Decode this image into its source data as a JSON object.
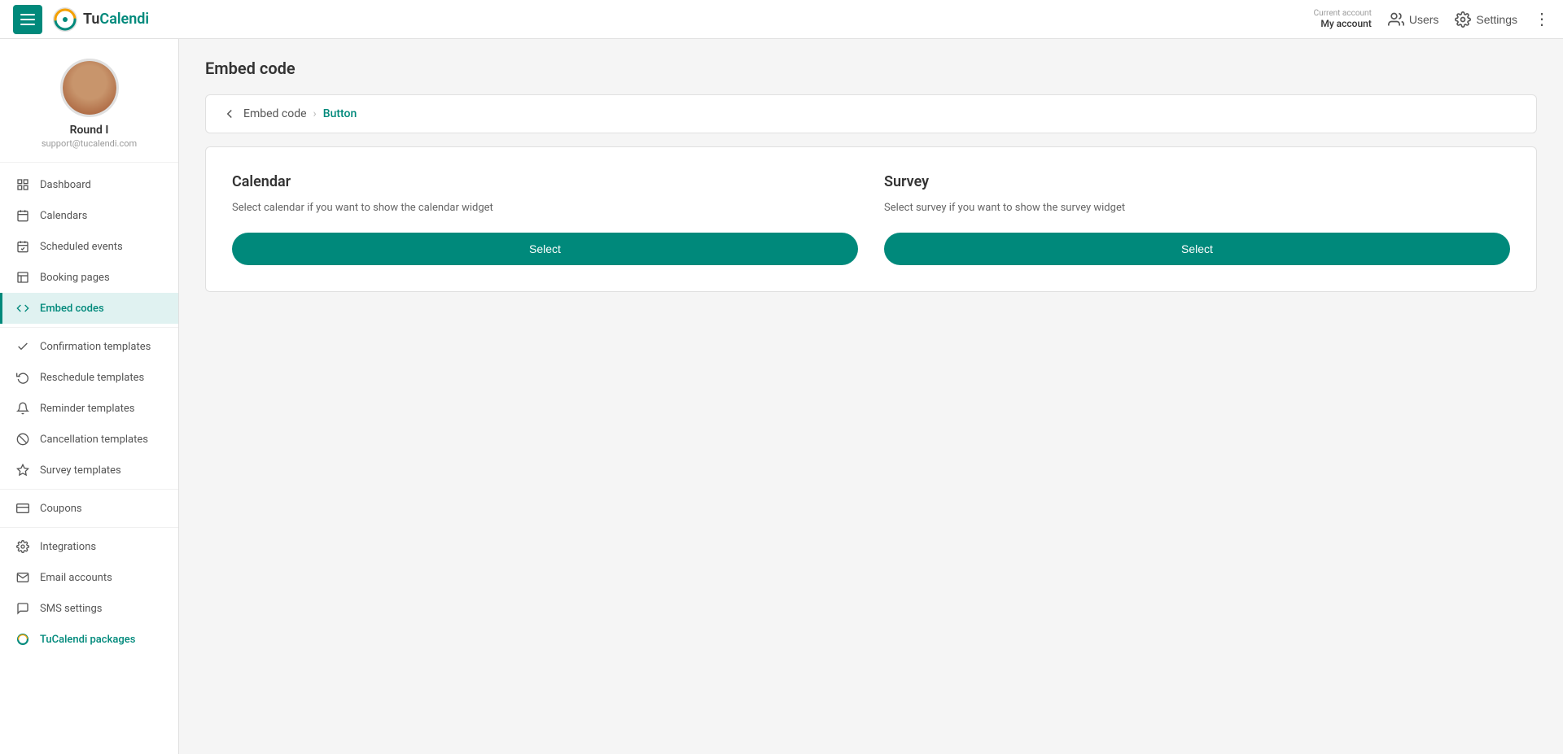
{
  "topbar": {
    "logo_text": "TuCalendi",
    "account_label": "Current account",
    "account_name": "My account",
    "users_label": "Users",
    "settings_label": "Settings"
  },
  "sidebar": {
    "profile": {
      "name": "Round I",
      "email": "support@tucalendi.com"
    },
    "nav_items": [
      {
        "id": "dashboard",
        "label": "Dashboard",
        "icon": "grid"
      },
      {
        "id": "calendars",
        "label": "Calendars",
        "icon": "calendar"
      },
      {
        "id": "scheduled-events",
        "label": "Scheduled events",
        "icon": "clock"
      },
      {
        "id": "booking-pages",
        "label": "Booking pages",
        "icon": "file"
      },
      {
        "id": "embed-codes",
        "label": "Embed codes",
        "icon": "code",
        "active": true
      },
      {
        "id": "confirmation-templates",
        "label": "Confirmation templates",
        "icon": "check"
      },
      {
        "id": "reschedule-templates",
        "label": "Reschedule templates",
        "icon": "refresh"
      },
      {
        "id": "reminder-templates",
        "label": "Reminder templates",
        "icon": "bell"
      },
      {
        "id": "cancellation-templates",
        "label": "Cancellation templates",
        "icon": "slash"
      },
      {
        "id": "survey-templates",
        "label": "Survey templates",
        "icon": "layers"
      },
      {
        "id": "coupons",
        "label": "Coupons",
        "icon": "coupon"
      },
      {
        "id": "integrations",
        "label": "Integrations",
        "icon": "settings"
      },
      {
        "id": "email-accounts",
        "label": "Email accounts",
        "icon": "mail"
      },
      {
        "id": "sms-settings",
        "label": "SMS settings",
        "icon": "sms"
      },
      {
        "id": "tucalendi-packages",
        "label": "TuCalendi packages",
        "icon": "logo",
        "special": true
      }
    ]
  },
  "main": {
    "page_title": "Embed code",
    "breadcrumb": {
      "back_label": "‹",
      "parent": "Embed code",
      "current": "Button"
    },
    "cards": [
      {
        "id": "calendar-card",
        "title": "Calendar",
        "description": "Select calendar if you want to show the calendar widget",
        "button_label": "Select"
      },
      {
        "id": "survey-card",
        "title": "Survey",
        "description": "Select survey if you want to show the survey widget",
        "button_label": "Select"
      }
    ]
  }
}
